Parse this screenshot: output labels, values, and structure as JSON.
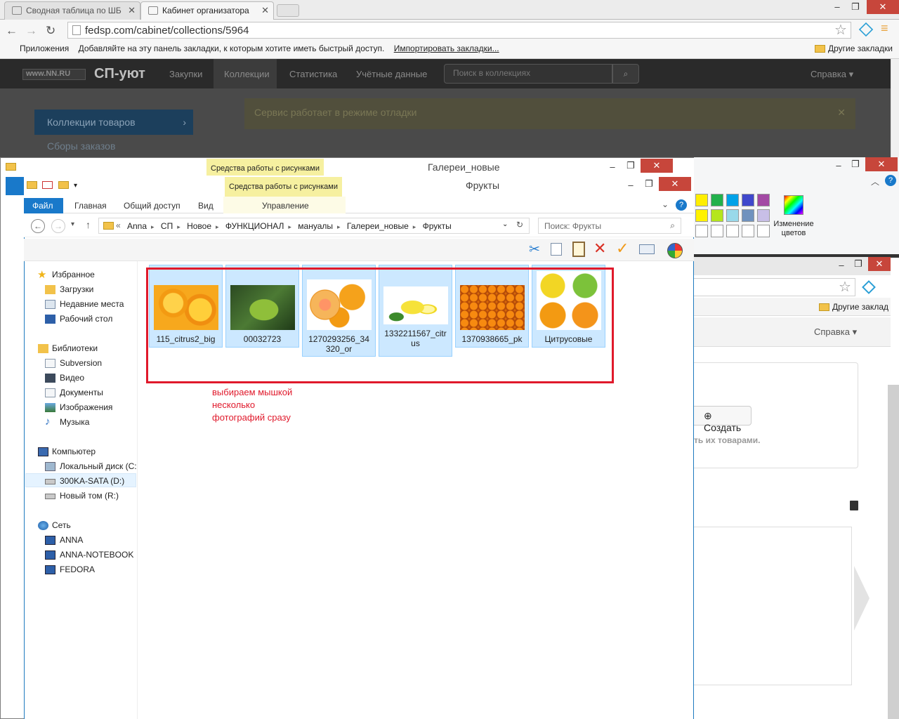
{
  "browser": {
    "tabs": [
      {
        "label": "Сводная таблица по ШБ"
      },
      {
        "label": "Кабинет организатора"
      }
    ],
    "url": "fedsp.com/cabinet/collections/5964",
    "bookmarks": {
      "apps": "Приложения",
      "hint": "Добавляйте на эту панель закладки, к которым хотите иметь быстрый доступ.",
      "import": "Импортировать закладки...",
      "other": "Другие закладки"
    }
  },
  "site": {
    "logo": "www.NN.RU",
    "brand": "СП-уют",
    "nav": [
      "Закупки",
      "Коллекции",
      "Статистика",
      "Учётные данные"
    ],
    "search_placeholder": "Поиск в коллекциях",
    "help": "Справка",
    "menu": [
      "Коллекции товаров",
      "Сборы заказов"
    ],
    "alert": "Сервис работает в режиме отладки"
  },
  "gallery_window": {
    "title": "Галереи_новые",
    "tools": "Средства работы с рисунками"
  },
  "paint": {
    "change_colors": "Изменение цветов",
    "palette": [
      "#ffee00",
      "#22b14c",
      "#00a2e8",
      "#3f48cc",
      "#a349a4",
      "#fff200",
      "#b5e61d",
      "#99d9ea",
      "#7092be",
      "#c8bfe7"
    ]
  },
  "chrome2": {
    "other": "Другие заклад",
    "help": "Справка",
    "create": "Создать",
    "hint": "ть их товарами."
  },
  "explorer": {
    "title": "Фрукты",
    "tools": "Средства работы с рисунками",
    "ribbon": [
      "Файл",
      "Главная",
      "Общий доступ",
      "Вид",
      "Управление"
    ],
    "breadcrumb": [
      "Anna",
      "СП",
      "Новое",
      "ФУНКЦИОНАЛ",
      "мануалы",
      "Галереи_новые",
      "Фрукты"
    ],
    "search_placeholder": "Поиск: Фрукты",
    "nav": {
      "favorites": "Избранное",
      "fav_items": [
        "Загрузки",
        "Недавние места",
        "Рабочий стол"
      ],
      "libraries": "Библиотеки",
      "lib_items": [
        "Subversion",
        "Видео",
        "Документы",
        "Изображения",
        "Музыка"
      ],
      "computer": "Компьютер",
      "comp_items": [
        "Локальный диск (C:",
        "300KA-SATA (D:)",
        "Новый том (R:)"
      ],
      "network": "Сеть",
      "net_items": [
        "ANNA",
        "ANNA-NOTEBOOK",
        "FEDORA"
      ]
    },
    "files": [
      {
        "name": "115_citrus2_big"
      },
      {
        "name": "00032723"
      },
      {
        "name": "1270293256_34320_or"
      },
      {
        "name": "1332211567_citrus"
      },
      {
        "name": "1370938665_pk"
      },
      {
        "name": "Цитрусовые"
      }
    ],
    "annotation": [
      "выбираем мышкой",
      "несколько",
      "фотографий сразу"
    ]
  }
}
